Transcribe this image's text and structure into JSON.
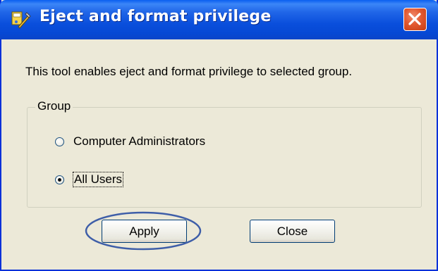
{
  "window": {
    "title": "Eject and format privilege",
    "title_icon": "tool-icon",
    "close_icon": "close-icon"
  },
  "description": "This tool enables eject and format privilege to selected group.",
  "group": {
    "legend": "Group",
    "options": [
      {
        "label": "Computer Administrators",
        "checked": false
      },
      {
        "label": "All Users",
        "checked": true
      }
    ]
  },
  "buttons": {
    "apply": "Apply",
    "close": "Close"
  },
  "colors": {
    "titlebar": "#0a4fdc",
    "dialog_bg": "#ece9d8",
    "close_button": "#e2582f",
    "highlight": "#3e5ea8"
  }
}
